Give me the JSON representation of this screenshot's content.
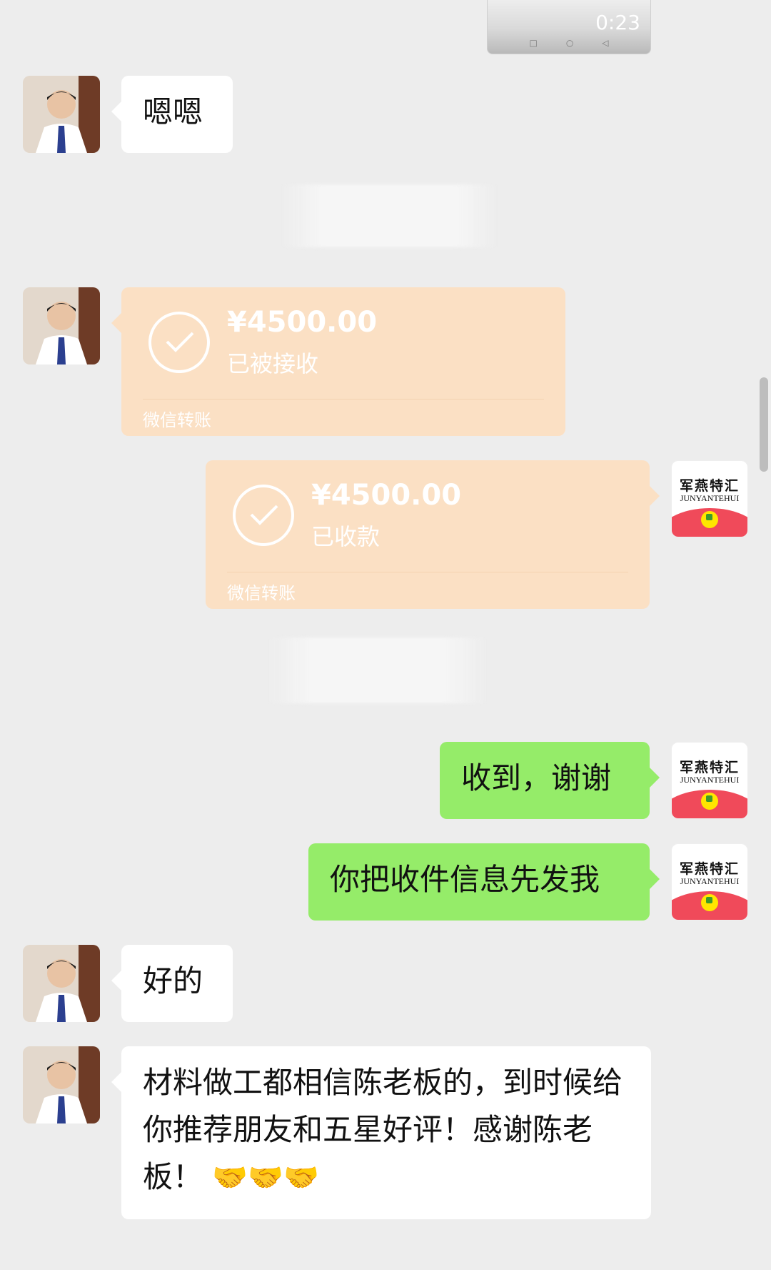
{
  "video": {
    "duration": "0:23"
  },
  "messages": {
    "m1": {
      "text": "嗯嗯"
    },
    "transfer_in": {
      "amount": "¥4500.00",
      "status": "已被接收",
      "label": "微信转账"
    },
    "transfer_out": {
      "amount": "¥4500.00",
      "status": "已收款",
      "label": "微信转账"
    },
    "m2": {
      "text": "收到，谢谢"
    },
    "m3": {
      "text": "你把收件信息先发我"
    },
    "m4": {
      "text": "好的"
    },
    "m5": {
      "text": "材料做工都相信陈老板的，到时候给你推荐朋友和五星好评！感谢陈老板！",
      "emojis": "🤝🤝🤝"
    }
  },
  "brand_avatar": {
    "title": "军燕特汇",
    "subtitle": "JUNYANTEHUI"
  }
}
